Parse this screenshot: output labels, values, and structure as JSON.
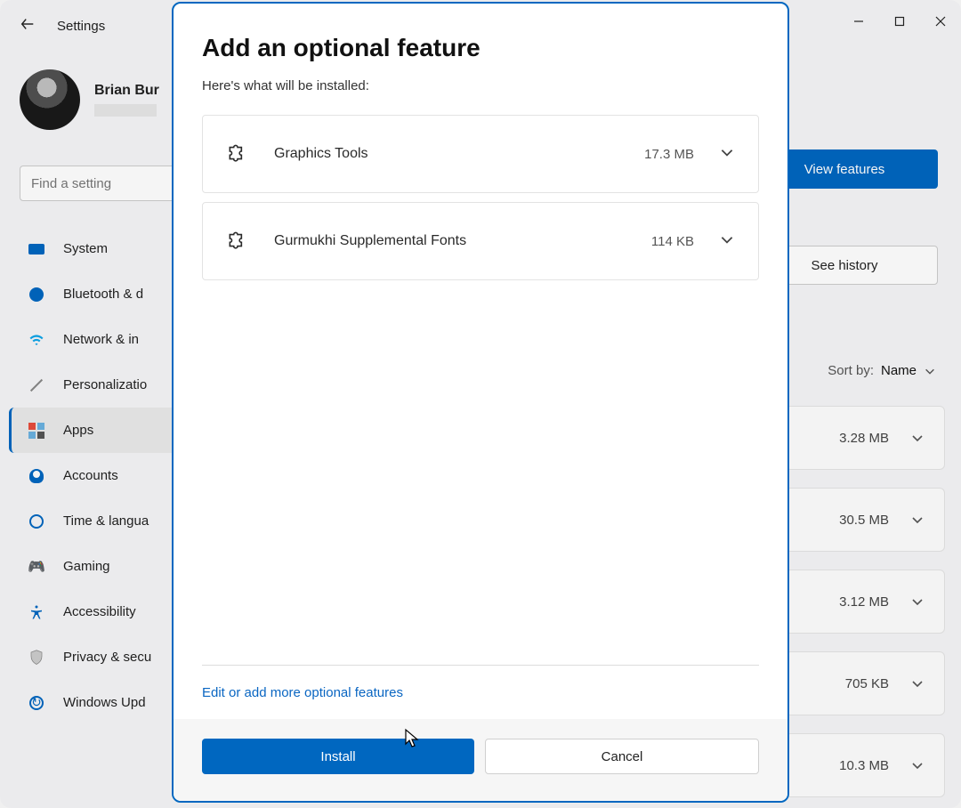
{
  "header": {
    "title": "Settings"
  },
  "profile": {
    "name": "Brian Bur"
  },
  "search": {
    "placeholder": "Find a setting"
  },
  "nav": {
    "items": [
      {
        "label": "System"
      },
      {
        "label": "Bluetooth & d"
      },
      {
        "label": "Network & in"
      },
      {
        "label": "Personalizatio"
      },
      {
        "label": "Apps"
      },
      {
        "label": "Accounts"
      },
      {
        "label": "Time & langua"
      },
      {
        "label": "Gaming"
      },
      {
        "label": "Accessibility"
      },
      {
        "label": "Privacy & secu"
      },
      {
        "label": "Windows Upd"
      }
    ]
  },
  "right": {
    "view_features": "View features",
    "see_history": "See history",
    "sort_label": "Sort by:",
    "sort_value": "Name",
    "rows": [
      {
        "size": "3.28 MB"
      },
      {
        "size": "30.5 MB"
      },
      {
        "size": "3.12 MB"
      },
      {
        "size": "705 KB"
      },
      {
        "size": "10.3 MB"
      }
    ]
  },
  "dialog": {
    "title": "Add an optional feature",
    "subtitle": "Here's what will be installed:",
    "items": [
      {
        "name": "Graphics Tools",
        "size": "17.3 MB"
      },
      {
        "name": "Gurmukhi Supplemental Fonts",
        "size": "114 KB"
      }
    ],
    "edit_link": "Edit or add more optional features",
    "install": "Install",
    "cancel": "Cancel"
  }
}
